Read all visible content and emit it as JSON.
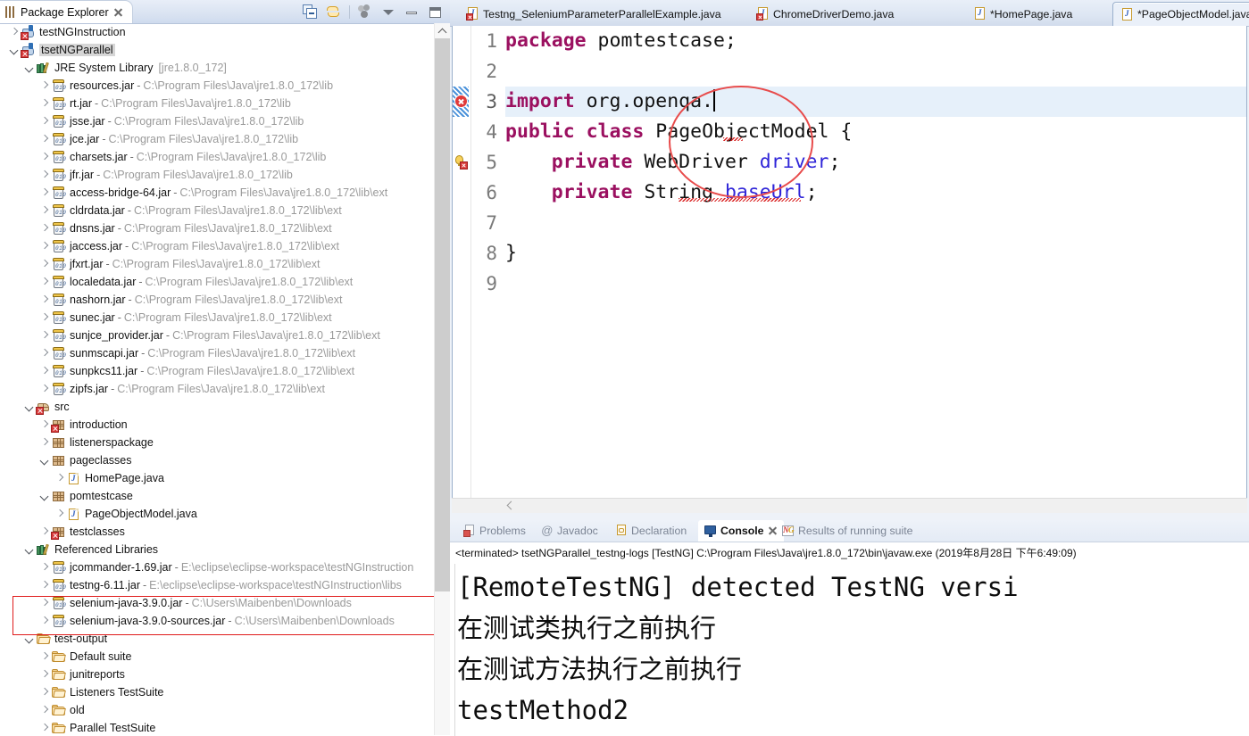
{
  "explorer": {
    "tab_label": "Package Explorer",
    "tab_icon": "package-explorer-icon",
    "toolbar": [
      {
        "name": "collapse-all-button",
        "icon": "collapse-all-icon"
      },
      {
        "name": "link-with-editor-button",
        "icon": "link-with-editor-icon"
      },
      {
        "name": "focus-on-active-task-button",
        "icon": "focus-task-icon"
      },
      {
        "name": "view-menu-button",
        "icon": "chevron-down-icon"
      },
      {
        "name": "minimize-button",
        "icon": "minimize-icon"
      },
      {
        "name": "maximize-button",
        "icon": "maximize-icon"
      }
    ],
    "tree": [
      {
        "indent": 0,
        "arrow": "closed",
        "icon": "java-project-error-icon",
        "name": "testNGInstruction",
        "sep": "",
        "path": "",
        "selected": false
      },
      {
        "indent": 0,
        "arrow": "open",
        "icon": "java-project-error-icon",
        "name": "tsetNGParallel",
        "sep": "",
        "path": "",
        "selected": true
      },
      {
        "indent": 1,
        "arrow": "open",
        "icon": "jre-library-icon",
        "name": "JRE System Library",
        "sep": " ",
        "path": "[jre1.8.0_172]",
        "selected": false
      },
      {
        "indent": 2,
        "arrow": "closed",
        "icon": "jar-icon",
        "name": "resources.jar",
        "sep": "-",
        "path": "C:\\Program Files\\Java\\jre1.8.0_172\\lib",
        "selected": false
      },
      {
        "indent": 2,
        "arrow": "closed",
        "icon": "jar-icon",
        "name": "rt.jar",
        "sep": "-",
        "path": "C:\\Program Files\\Java\\jre1.8.0_172\\lib",
        "selected": false
      },
      {
        "indent": 2,
        "arrow": "closed",
        "icon": "jar-icon",
        "name": "jsse.jar",
        "sep": "-",
        "path": "C:\\Program Files\\Java\\jre1.8.0_172\\lib",
        "selected": false
      },
      {
        "indent": 2,
        "arrow": "closed",
        "icon": "jar-icon",
        "name": "jce.jar",
        "sep": "-",
        "path": "C:\\Program Files\\Java\\jre1.8.0_172\\lib",
        "selected": false
      },
      {
        "indent": 2,
        "arrow": "closed",
        "icon": "jar-icon",
        "name": "charsets.jar",
        "sep": "-",
        "path": "C:\\Program Files\\Java\\jre1.8.0_172\\lib",
        "selected": false
      },
      {
        "indent": 2,
        "arrow": "closed",
        "icon": "jar-icon",
        "name": "jfr.jar",
        "sep": "-",
        "path": "C:\\Program Files\\Java\\jre1.8.0_172\\lib",
        "selected": false
      },
      {
        "indent": 2,
        "arrow": "closed",
        "icon": "jar-icon",
        "name": "access-bridge-64.jar",
        "sep": "-",
        "path": "C:\\Program Files\\Java\\jre1.8.0_172\\lib\\ext",
        "selected": false
      },
      {
        "indent": 2,
        "arrow": "closed",
        "icon": "jar-icon",
        "name": "cldrdata.jar",
        "sep": "-",
        "path": "C:\\Program Files\\Java\\jre1.8.0_172\\lib\\ext",
        "selected": false
      },
      {
        "indent": 2,
        "arrow": "closed",
        "icon": "jar-icon",
        "name": "dnsns.jar",
        "sep": "-",
        "path": "C:\\Program Files\\Java\\jre1.8.0_172\\lib\\ext",
        "selected": false
      },
      {
        "indent": 2,
        "arrow": "closed",
        "icon": "jar-icon",
        "name": "jaccess.jar",
        "sep": "-",
        "path": "C:\\Program Files\\Java\\jre1.8.0_172\\lib\\ext",
        "selected": false
      },
      {
        "indent": 2,
        "arrow": "closed",
        "icon": "jar-icon",
        "name": "jfxrt.jar",
        "sep": "-",
        "path": "C:\\Program Files\\Java\\jre1.8.0_172\\lib\\ext",
        "selected": false
      },
      {
        "indent": 2,
        "arrow": "closed",
        "icon": "jar-icon",
        "name": "localedata.jar",
        "sep": "-",
        "path": "C:\\Program Files\\Java\\jre1.8.0_172\\lib\\ext",
        "selected": false
      },
      {
        "indent": 2,
        "arrow": "closed",
        "icon": "jar-icon",
        "name": "nashorn.jar",
        "sep": "-",
        "path": "C:\\Program Files\\Java\\jre1.8.0_172\\lib\\ext",
        "selected": false
      },
      {
        "indent": 2,
        "arrow": "closed",
        "icon": "jar-icon",
        "name": "sunec.jar",
        "sep": "-",
        "path": "C:\\Program Files\\Java\\jre1.8.0_172\\lib\\ext",
        "selected": false
      },
      {
        "indent": 2,
        "arrow": "closed",
        "icon": "jar-icon",
        "name": "sunjce_provider.jar",
        "sep": "-",
        "path": "C:\\Program Files\\Java\\jre1.8.0_172\\lib\\ext",
        "selected": false
      },
      {
        "indent": 2,
        "arrow": "closed",
        "icon": "jar-icon",
        "name": "sunmscapi.jar",
        "sep": "-",
        "path": "C:\\Program Files\\Java\\jre1.8.0_172\\lib\\ext",
        "selected": false
      },
      {
        "indent": 2,
        "arrow": "closed",
        "icon": "jar-icon",
        "name": "sunpkcs11.jar",
        "sep": "-",
        "path": "C:\\Program Files\\Java\\jre1.8.0_172\\lib\\ext",
        "selected": false
      },
      {
        "indent": 2,
        "arrow": "closed",
        "icon": "jar-icon",
        "name": "zipfs.jar",
        "sep": "-",
        "path": "C:\\Program Files\\Java\\jre1.8.0_172\\lib\\ext",
        "selected": false
      },
      {
        "indent": 1,
        "arrow": "open",
        "icon": "source-folder-error-icon",
        "name": "src",
        "sep": "",
        "path": "",
        "selected": false
      },
      {
        "indent": 2,
        "arrow": "closed",
        "icon": "package-error-icon",
        "name": "introduction",
        "sep": "",
        "path": "",
        "selected": false
      },
      {
        "indent": 2,
        "arrow": "closed",
        "icon": "package-icon",
        "name": "listenerspackage",
        "sep": "",
        "path": "",
        "selected": false
      },
      {
        "indent": 2,
        "arrow": "open",
        "icon": "package-icon",
        "name": "pageclasses",
        "sep": "",
        "path": "",
        "selected": false
      },
      {
        "indent": 3,
        "arrow": "closed",
        "icon": "java-file-icon",
        "name": "HomePage.java",
        "sep": "",
        "path": "",
        "selected": false
      },
      {
        "indent": 2,
        "arrow": "open",
        "icon": "package-icon",
        "name": "pomtestcase",
        "sep": "",
        "path": "",
        "selected": false
      },
      {
        "indent": 3,
        "arrow": "closed",
        "icon": "java-file-icon",
        "name": "PageObjectModel.java",
        "sep": "",
        "path": "",
        "selected": false
      },
      {
        "indent": 2,
        "arrow": "closed",
        "icon": "package-error-icon",
        "name": "testclasses",
        "sep": "",
        "path": "",
        "selected": false
      },
      {
        "indent": 1,
        "arrow": "open",
        "icon": "referenced-libraries-icon",
        "name": "Referenced Libraries",
        "sep": "",
        "path": "",
        "selected": false
      },
      {
        "indent": 2,
        "arrow": "closed",
        "icon": "jar-icon",
        "name": "jcommander-1.69.jar",
        "sep": "-",
        "path": "E:\\eclipse\\eclipse-workspace\\testNGInstruction",
        "selected": false
      },
      {
        "indent": 2,
        "arrow": "closed",
        "icon": "jar-icon",
        "name": "testng-6.11.jar",
        "sep": "-",
        "path": "E:\\eclipse\\eclipse-workspace\\testNGInstruction\\libs",
        "selected": false
      },
      {
        "indent": 2,
        "arrow": "closed",
        "icon": "jar-icon",
        "name": "selenium-java-3.9.0.jar",
        "sep": "-",
        "path": "C:\\Users\\Maibenben\\Downloads",
        "selected": false
      },
      {
        "indent": 2,
        "arrow": "closed",
        "icon": "jar-icon",
        "name": "selenium-java-3.9.0-sources.jar",
        "sep": "-",
        "path": "C:\\Users\\Maibenben\\Downloads",
        "selected": false
      },
      {
        "indent": 1,
        "arrow": "open",
        "icon": "folder-icon",
        "name": "test-output",
        "sep": "",
        "path": "",
        "selected": false
      },
      {
        "indent": 2,
        "arrow": "closed",
        "icon": "folder-icon",
        "name": "Default suite",
        "sep": "",
        "path": "",
        "selected": false
      },
      {
        "indent": 2,
        "arrow": "closed",
        "icon": "folder-icon",
        "name": "junitreports",
        "sep": "",
        "path": "",
        "selected": false
      },
      {
        "indent": 2,
        "arrow": "closed",
        "icon": "folder-icon",
        "name": "Listeners TestSuite",
        "sep": "",
        "path": "",
        "selected": false
      },
      {
        "indent": 2,
        "arrow": "closed",
        "icon": "folder-icon",
        "name": "old",
        "sep": "",
        "path": "",
        "selected": false
      },
      {
        "indent": 2,
        "arrow": "closed",
        "icon": "folder-icon",
        "name": "Parallel TestSuite",
        "sep": "",
        "path": "",
        "selected": false
      }
    ],
    "annotation_box_label": "selenium-jars-highlight"
  },
  "editor": {
    "tabs": [
      {
        "label": "Testng_SeleniumParameterParallelExample.java",
        "icon": "java-file-error-icon",
        "active": false,
        "closable": false
      },
      {
        "label": "ChromeDriverDemo.java",
        "icon": "java-file-error-icon",
        "active": false,
        "closable": false
      },
      {
        "label": "*HomePage.java",
        "icon": "java-file-icon",
        "active": false,
        "closable": false
      },
      {
        "label": "*PageObjectModel.java",
        "icon": "java-file-icon",
        "active": true,
        "closable": true
      }
    ],
    "line_numbers": [
      "1",
      "2",
      "3",
      "4",
      "5",
      "6",
      "7",
      "8",
      "9"
    ],
    "current_line": "3",
    "markers": [
      {
        "line": "3",
        "type": "error-marker-icon"
      },
      {
        "line": "5",
        "type": "quickfix-warning-marker-icon"
      }
    ],
    "code_lines": [
      [
        {
          "t": "package",
          "c": "kw"
        },
        {
          "t": " pomtestcase;",
          "c": "plain"
        }
      ],
      [],
      [
        {
          "t": "import",
          "c": "kw"
        },
        {
          "t": " org.openqa.",
          "c": "plain"
        }
      ],
      [
        {
          "t": "public",
          "c": "kw"
        },
        {
          "t": " ",
          "c": "plain"
        },
        {
          "t": "class",
          "c": "kw"
        },
        {
          "t": " PageObjectModel {",
          "c": "plain"
        }
      ],
      [
        {
          "t": "    ",
          "c": "plain"
        },
        {
          "t": "private",
          "c": "kw"
        },
        {
          "t": " WebDriver ",
          "c": "plain"
        },
        {
          "t": "driver",
          "c": "fld"
        },
        {
          "t": ";",
          "c": "plain"
        }
      ],
      [
        {
          "t": "    ",
          "c": "plain"
        },
        {
          "t": "private",
          "c": "kw"
        },
        {
          "t": " String ",
          "c": "plain"
        },
        {
          "t": "baseUrl",
          "c": "fld"
        },
        {
          "t": ";",
          "c": "plain"
        }
      ],
      [],
      [
        {
          "t": "}",
          "c": "plain"
        }
      ],
      []
    ],
    "annotation_ellipse_label": "red-circle-annotation"
  },
  "bottom_panel": {
    "tabs": [
      {
        "label": "Problems",
        "icon": "problems-icon",
        "active": false,
        "closable": false
      },
      {
        "label": "Javadoc",
        "icon": "javadoc-icon",
        "active": false,
        "closable": false
      },
      {
        "label": "Declaration",
        "icon": "declaration-icon",
        "active": false,
        "closable": false
      },
      {
        "label": "Console",
        "icon": "console-icon",
        "active": true,
        "closable": true
      },
      {
        "label": "Results of running suite",
        "icon": "testng-results-icon",
        "active": false,
        "closable": false
      }
    ],
    "launch_line": "<terminated> tsetNGParallel_testng-logs [TestNG] C:\\Program Files\\Java\\jre1.8.0_172\\bin\\javaw.exe (2019年8月28日 下午6:49:09)",
    "output_lines": [
      "[RemoteTestNG] detected TestNG versi",
      "在测试类执行之前执行",
      "在测试方法执行之前执行",
      "testMethod2"
    ]
  },
  "colors": {
    "accent_blue": "#2e5f9e",
    "annotation_red": "#e01b1b",
    "keyword_purple": "#9b1060",
    "field_blue": "#2f25d8",
    "selection_blue": "#e6f0fa"
  }
}
